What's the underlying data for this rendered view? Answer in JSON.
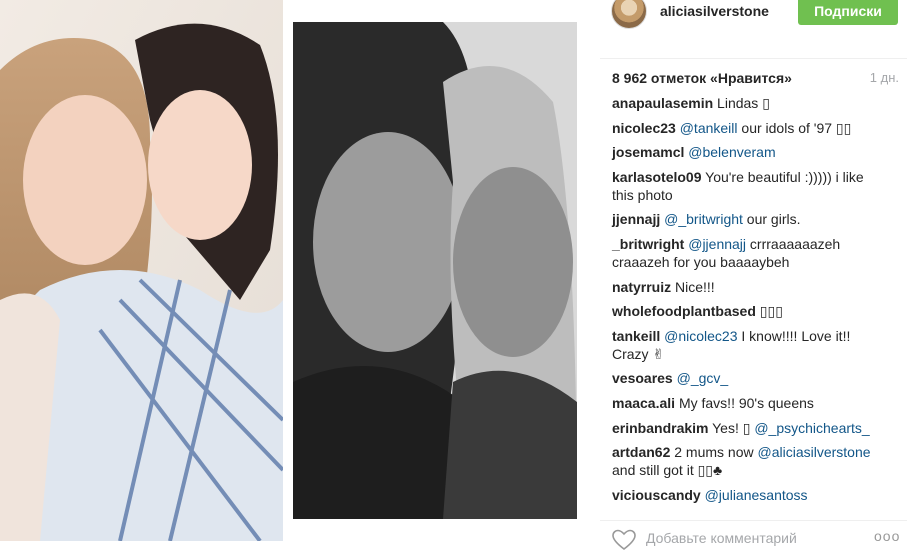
{
  "post": {
    "username": "aliciasilverstone",
    "follow_label": "Подписки",
    "likes_text": "8 962 отметок «Нравится»",
    "time_text": "1 дн.",
    "add_comment_placeholder": "Добавьте комментарий",
    "more_label": "ooo"
  },
  "comments": [
    {
      "user": "anapaulasemin",
      "text": " Lindas ▯"
    },
    {
      "user": "nicolec23",
      "mention": "@tankeill",
      "text": " our idols of '97 ▯▯"
    },
    {
      "user": "josemamcl",
      "mention": "@belenveram",
      "text": ""
    },
    {
      "user": "karlasotelo09",
      "text": " You're beautiful :))))) i like this photo"
    },
    {
      "user": "jjennajj",
      "mention": "@_britwright",
      "text": " our girls."
    },
    {
      "user": "_britwright",
      "mention": "@jjennajj",
      "text": " crrraaaaaazeh craaazeh for you baaaaybeh"
    },
    {
      "user": "natyrruiz",
      "text": " Nice!!!"
    },
    {
      "user": "wholefoodplantbased",
      "text": " ▯▯▯"
    },
    {
      "user": "tankeill",
      "mention": "@nicolec23",
      "text": " I know!!!! Love it!! Crazy ✌"
    },
    {
      "user": "vesoares",
      "mention": "@_gcv_",
      "text": ""
    },
    {
      "user": "maaca.ali",
      "text": " My favs!! 90's queens"
    },
    {
      "user": "erinbandrakim",
      "text": " Yes! ▯ ",
      "mention_after": "@_psychichearts_"
    },
    {
      "user": "artdan62",
      "text": " 2 mums now ",
      "mention_after": "@aliciasilverstone",
      "text_after": " and still got it ▯▯♣"
    },
    {
      "user": "viciouscandy",
      "mention": "@julianesantoss",
      "text": ""
    }
  ],
  "icons": {
    "heart": "heart-outline-icon",
    "more": "more-dots-icon"
  },
  "colors": {
    "follow_button": "#70c050",
    "mention": "#125688",
    "muted": "#a5a7aa"
  }
}
